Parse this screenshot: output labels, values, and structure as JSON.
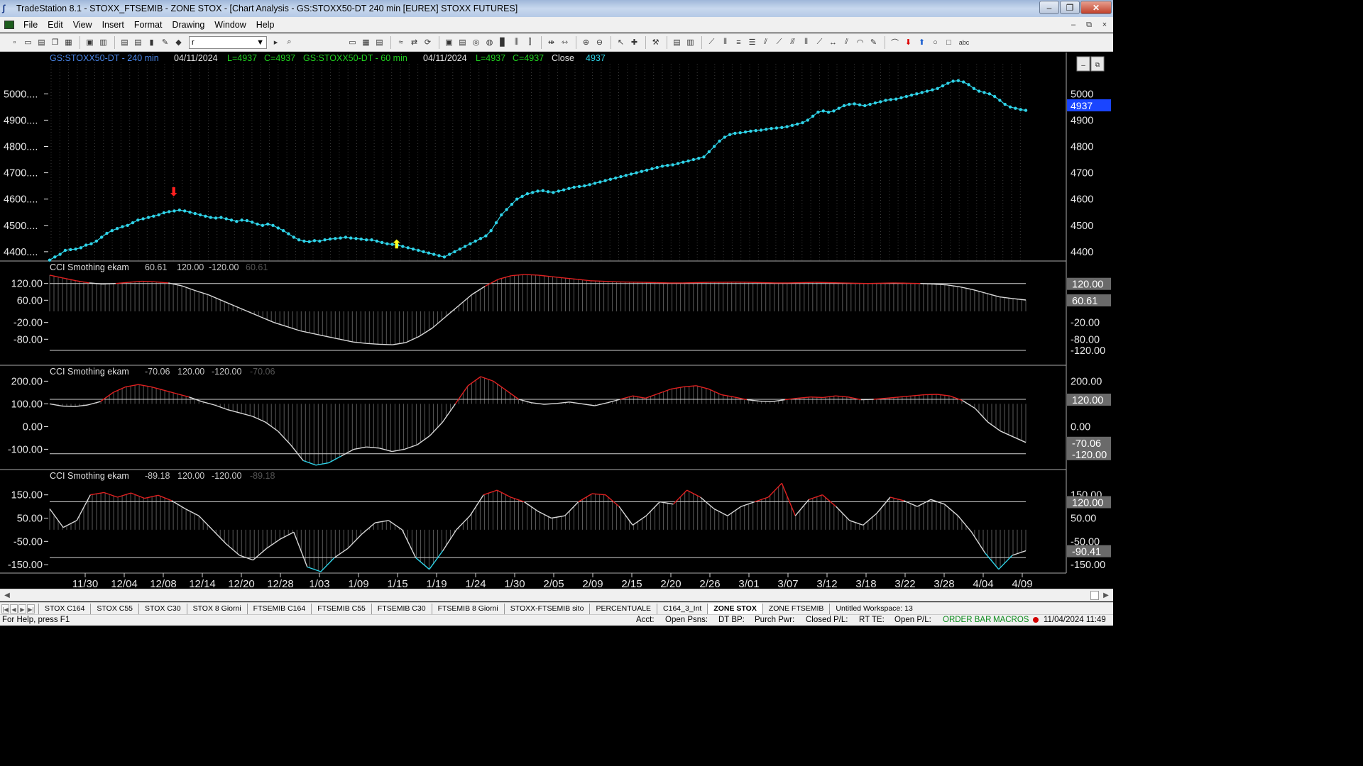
{
  "window": {
    "title": "TradeStation 8.1 - STOXX_FTSEMIB - ZONE STOX - [Chart Analysis - GS:STOXX50-DT  240 min  [EUREX] STOXX FUTURES]",
    "minimize_label": "‒",
    "restore_label": "❐",
    "close_label": "✕"
  },
  "menu": {
    "items": [
      "File",
      "Edit",
      "View",
      "Insert",
      "Format",
      "Drawing",
      "Window",
      "Help"
    ],
    "mdi_minimize": "–",
    "mdi_restore": "⧉",
    "mdi_close": "×"
  },
  "toolbar": {
    "symbol_select_value": "r",
    "icons": [
      "new-icon",
      "open-icon",
      "save-icon",
      "copy-icon",
      "print-icon",
      "print-preview-icon",
      "format-icon",
      "lock-icon",
      "tools-icon",
      "macro-icon",
      "find-icon",
      "window-icon",
      "grid-icon",
      "layout-icon",
      "refresh-icon",
      "link-icon",
      "chart-icon",
      "scale-icon",
      "zoom-in-icon",
      "zoom-out-icon",
      "pointer-icon",
      "crosshair-icon",
      "wrench-icon",
      "insert-icon",
      "trendline-icon",
      "horizontal-line-icon",
      "vertical-line-icon",
      "fib-icon",
      "channel-icon",
      "arrow-down-icon",
      "arrow-up-icon",
      "ellipse-icon",
      "rectangle-icon",
      "text-icon"
    ],
    "text_tool_label": "abc"
  },
  "chart": {
    "header": {
      "symbol1": "GS:STOXX50-DT - 240 min",
      "date1": "04/11/2024",
      "low1": "L=4937",
      "close1": "C=4937",
      "symbol2": "GS:STOXX50-DT - 60 min",
      "date2": "04/11/2024",
      "low2": "L=4937",
      "close2": "C=4937",
      "close_label": "Close",
      "close_value": "4937"
    },
    "price_axis_left": [
      "5000....",
      "4900....",
      "4800....",
      "4700....",
      "4600....",
      "4500....",
      "4400...."
    ],
    "price_axis_right": [
      "5000",
      "4900",
      "4800",
      "4700",
      "4600",
      "4500",
      "4400"
    ],
    "last_price_tag": "4937",
    "x_axis": [
      "11/30",
      "12/04",
      "12/08",
      "12/14",
      "12/20",
      "12/28",
      "1/03",
      "1/09",
      "1/15",
      "1/19",
      "1/24",
      "1/30",
      "2/05",
      "2/09",
      "2/15",
      "2/20",
      "2/26",
      "3/01",
      "3/07",
      "3/12",
      "3/18",
      "3/22",
      "3/28",
      "4/04",
      "4/09"
    ],
    "colors": {
      "price_line": "#2fd3e8",
      "cci_above": "#e02020",
      "cci_normal": "#d8d8d8",
      "cci_below": "#2fd3e8",
      "header_symbol": "#4a86e8",
      "header_green": "#20d020",
      "sell_arrow": "#ff2020",
      "buy_arrow": "#ffff20"
    },
    "panes": [
      {
        "name": "CCI Smothing ekam",
        "value": "60.61",
        "upper": "120.00",
        "lower": "-120.00",
        "ghost": "60.61",
        "left_ticks": [
          "120.00",
          "60.00",
          "-20.00",
          "-80.00"
        ],
        "right_ticks": [
          "-20.00",
          "-80.00",
          "-120.00"
        ],
        "right_tags": [
          "120.00",
          "60.61"
        ]
      },
      {
        "name": "CCI Smothing ekam",
        "value": "-70.06",
        "upper": "120.00",
        "lower": "-120.00",
        "ghost": "-70.06",
        "left_ticks": [
          "200.00",
          "100.00",
          "0.00",
          "-100.00"
        ],
        "right_ticks": [
          "200.00",
          "0.00"
        ],
        "right_tags": [
          "120.00",
          "-70.06",
          "-120.00"
        ]
      },
      {
        "name": "CCI Smothing ekam",
        "value": "-89.18",
        "upper": "120.00",
        "lower": "-120.00",
        "ghost": "-89.18",
        "left_ticks": [
          "150.00",
          "50.00",
          "-50.00",
          "-150.00"
        ],
        "right_ticks": [
          "150.00",
          "50.00",
          "-50.00",
          "-150.00"
        ],
        "right_tags": [
          "120.00",
          "-90.41"
        ]
      }
    ]
  },
  "chart_data": [
    {
      "type": "line",
      "title": "GS:STOXX50-DT - 240 min",
      "ylim": [
        4370,
        5060
      ],
      "x_ticks": [
        "11/30",
        "12/04",
        "12/08",
        "12/14",
        "12/20",
        "12/28",
        "1/03",
        "1/09",
        "1/15",
        "1/19",
        "1/24",
        "1/30",
        "2/05",
        "2/09",
        "2/15",
        "2/20",
        "2/26",
        "3/01",
        "3/07",
        "3/12",
        "3/18",
        "3/22",
        "3/28",
        "4/04",
        "4/09"
      ],
      "series": [
        {
          "name": "Close",
          "values": [
            4368,
            4380,
            4390,
            4405,
            4408,
            4410,
            4415,
            4425,
            4430,
            4440,
            4455,
            4470,
            4480,
            4488,
            4495,
            4500,
            4510,
            4520,
            4525,
            4530,
            4535,
            4540,
            4548,
            4552,
            4555,
            4558,
            4555,
            4550,
            4545,
            4540,
            4535,
            4530,
            4528,
            4530,
            4525,
            4520,
            4515,
            4520,
            4518,
            4512,
            4505,
            4500,
            4505,
            4500,
            4490,
            4480,
            4468,
            4455,
            4445,
            4440,
            4438,
            4442,
            4440,
            4445,
            4448,
            4450,
            4452,
            4455,
            4452,
            4450,
            4448,
            4445,
            4445,
            4440,
            4435,
            4430,
            4428,
            4425,
            4420,
            4415,
            4410,
            4405,
            4400,
            4395,
            4390,
            4385,
            4380,
            4390,
            4400,
            4410,
            4420,
            4430,
            4440,
            4450,
            4460,
            4480,
            4510,
            4540,
            4560,
            4580,
            4600,
            4610,
            4620,
            4625,
            4630,
            4632,
            4628,
            4625,
            4630,
            4635,
            4640,
            4645,
            4648,
            4650,
            4655,
            4660,
            4665,
            4670,
            4675,
            4680,
            4685,
            4690,
            4695,
            4700,
            4705,
            4710,
            4715,
            4720,
            4725,
            4728,
            4730,
            4735,
            4740,
            4745,
            4750,
            4755,
            4760,
            4780,
            4800,
            4820,
            4835,
            4845,
            4850,
            4852,
            4855,
            4858,
            4860,
            4862,
            4865,
            4868,
            4870,
            4872,
            4875,
            4880,
            4885,
            4890,
            4900,
            4915,
            4930,
            4935,
            4930,
            4935,
            4945,
            4955,
            4960,
            4962,
            4958,
            4955,
            4960,
            4965,
            4970,
            4975,
            4978,
            4980,
            4985,
            4990,
            4995,
            5000,
            5005,
            5010,
            5015,
            5020,
            5030,
            5040,
            5048,
            5050,
            5045,
            5035,
            5020,
            5010,
            5005,
            5000,
            4990,
            4975,
            4960,
            4950,
            4945,
            4940,
            4937
          ]
        }
      ]
    },
    {
      "type": "line",
      "title": "CCI Smothing ekam",
      "ylim": [
        -120,
        160
      ],
      "series": [
        {
          "name": "CCI Smothing ekam",
          "values": [
            150,
            140,
            130,
            122,
            118,
            120,
            124,
            128,
            126,
            122,
            112,
            95,
            80,
            60,
            40,
            20,
            0,
            -20,
            -35,
            -50,
            -60,
            -70,
            -80,
            -90,
            -95,
            -98,
            -100,
            -92,
            -70,
            -40,
            0,
            40,
            80,
            110,
            135,
            148,
            152,
            150,
            145,
            140,
            135,
            130,
            128,
            126,
            125,
            124,
            123,
            122,
            122,
            123,
            124,
            124,
            125,
            124,
            123,
            122,
            122,
            123,
            124,
            123,
            122,
            121,
            120,
            121,
            122,
            121,
            120,
            118,
            115,
            108,
            98,
            85,
            72,
            66,
            60.61
          ]
        }
      ]
    },
    {
      "type": "line",
      "title": "CCI Smothing ekam",
      "ylim": [
        -180,
        220
      ],
      "series": [
        {
          "name": "CCI Smothing ekam",
          "values": [
            100,
            90,
            88,
            95,
            110,
            150,
            175,
            185,
            175,
            160,
            145,
            130,
            110,
            95,
            75,
            60,
            45,
            20,
            -20,
            -80,
            -150,
            -170,
            -160,
            -130,
            -100,
            -90,
            -95,
            -110,
            -100,
            -80,
            -40,
            20,
            100,
            180,
            220,
            200,
            160,
            120,
            105,
            98,
            102,
            108,
            100,
            92,
            105,
            120,
            135,
            125,
            145,
            165,
            175,
            180,
            165,
            140,
            130,
            118,
            112,
            110,
            118,
            125,
            130,
            128,
            135,
            130,
            118,
            120,
            125,
            130,
            135,
            140,
            142,
            135,
            115,
            80,
            20,
            -20,
            -45,
            -70.06
          ]
        }
      ]
    },
    {
      "type": "line",
      "title": "CCI Smothing ekam",
      "ylim": [
        -180,
        210
      ],
      "series": [
        {
          "name": "CCI Smothing ekam",
          "values": [
            90,
            10,
            40,
            150,
            160,
            140,
            158,
            135,
            148,
            125,
            90,
            60,
            0,
            -60,
            -110,
            -130,
            -80,
            -40,
            -10,
            -160,
            -180,
            -120,
            -80,
            -20,
            30,
            40,
            0,
            -120,
            -170,
            -90,
            0,
            60,
            150,
            170,
            140,
            120,
            80,
            50,
            60,
            120,
            155,
            150,
            100,
            20,
            60,
            120,
            110,
            170,
            140,
            90,
            60,
            100,
            120,
            140,
            200,
            60,
            130,
            150,
            100,
            40,
            20,
            70,
            140,
            125,
            100,
            130,
            110,
            60,
            -10,
            -100,
            -170,
            -110,
            -90.41
          ]
        }
      ]
    }
  ],
  "scroll": {
    "left_label": "◀",
    "right_label": "▶"
  },
  "tabs": {
    "nav": [
      "|◀",
      "◀",
      "▶",
      "▶|"
    ],
    "items": [
      "STOX C164",
      "STOX C55",
      "STOX  C30",
      "STOX  8 Giorni",
      "FTSEMIB C164",
      "FTSEMIB C55",
      "FTSEMIB C30",
      "FTSEMIB  8 Giorni",
      "STOXX-FTSEMIB sito",
      "PERCENTUALE",
      "C164_3_Int",
      "ZONE STOX",
      "ZONE FTSEMIB",
      "Untitled Workspace:  13"
    ],
    "active_index": 11
  },
  "status": {
    "help": "For Help, press F1",
    "acct": "Acct:",
    "open_psns": "Open Psns:",
    "dt_bp": "DT BP:",
    "purch_pwr": "Purch Pwr:",
    "closed_pl": "Closed P/L:",
    "rt_te": "RT TE:",
    "open_pl": "Open P/L:",
    "order_bar": "ORDER BAR",
    "macros": "MACROS",
    "datetime": "11/04/2024 11:49"
  }
}
